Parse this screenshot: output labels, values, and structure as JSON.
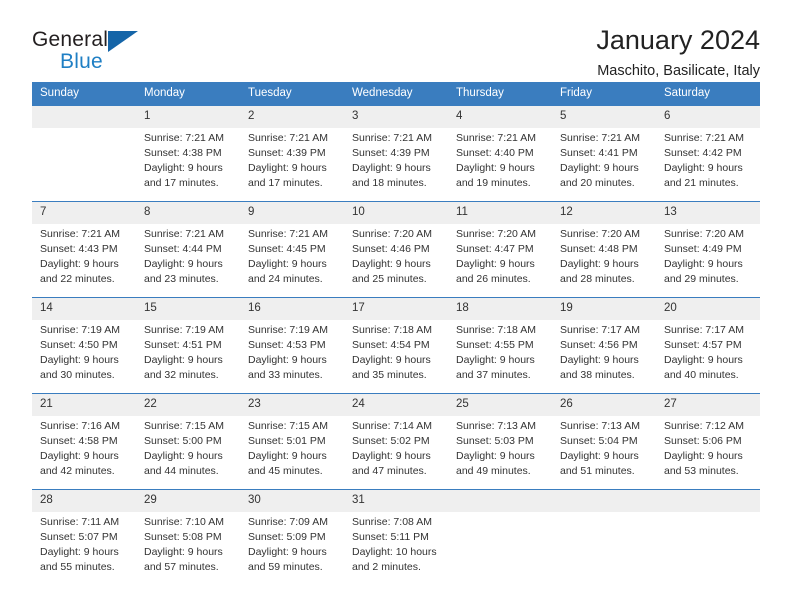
{
  "brand": {
    "name_top": "General",
    "name_bottom": "Blue",
    "triangle_icon": "triangle-logo-icon",
    "accent_color": "#1f7fc4"
  },
  "header": {
    "title": "January 2024",
    "subtitle": "Maschito, Basilicate, Italy"
  },
  "calendar": {
    "header_color": "#3a7dbf",
    "daynum_bg": "#efefef",
    "weekdays": [
      "Sunday",
      "Monday",
      "Tuesday",
      "Wednesday",
      "Thursday",
      "Friday",
      "Saturday"
    ],
    "weeks": [
      [
        {
          "day": "",
          "lines": [
            "",
            "",
            "",
            ""
          ]
        },
        {
          "day": "1",
          "lines": [
            "Sunrise: 7:21 AM",
            "Sunset: 4:38 PM",
            "Daylight: 9 hours",
            "and 17 minutes."
          ]
        },
        {
          "day": "2",
          "lines": [
            "Sunrise: 7:21 AM",
            "Sunset: 4:39 PM",
            "Daylight: 9 hours",
            "and 17 minutes."
          ]
        },
        {
          "day": "3",
          "lines": [
            "Sunrise: 7:21 AM",
            "Sunset: 4:39 PM",
            "Daylight: 9 hours",
            "and 18 minutes."
          ]
        },
        {
          "day": "4",
          "lines": [
            "Sunrise: 7:21 AM",
            "Sunset: 4:40 PM",
            "Daylight: 9 hours",
            "and 19 minutes."
          ]
        },
        {
          "day": "5",
          "lines": [
            "Sunrise: 7:21 AM",
            "Sunset: 4:41 PM",
            "Daylight: 9 hours",
            "and 20 minutes."
          ]
        },
        {
          "day": "6",
          "lines": [
            "Sunrise: 7:21 AM",
            "Sunset: 4:42 PM",
            "Daylight: 9 hours",
            "and 21 minutes."
          ]
        }
      ],
      [
        {
          "day": "7",
          "lines": [
            "Sunrise: 7:21 AM",
            "Sunset: 4:43 PM",
            "Daylight: 9 hours",
            "and 22 minutes."
          ]
        },
        {
          "day": "8",
          "lines": [
            "Sunrise: 7:21 AM",
            "Sunset: 4:44 PM",
            "Daylight: 9 hours",
            "and 23 minutes."
          ]
        },
        {
          "day": "9",
          "lines": [
            "Sunrise: 7:21 AM",
            "Sunset: 4:45 PM",
            "Daylight: 9 hours",
            "and 24 minutes."
          ]
        },
        {
          "day": "10",
          "lines": [
            "Sunrise: 7:20 AM",
            "Sunset: 4:46 PM",
            "Daylight: 9 hours",
            "and 25 minutes."
          ]
        },
        {
          "day": "11",
          "lines": [
            "Sunrise: 7:20 AM",
            "Sunset: 4:47 PM",
            "Daylight: 9 hours",
            "and 26 minutes."
          ]
        },
        {
          "day": "12",
          "lines": [
            "Sunrise: 7:20 AM",
            "Sunset: 4:48 PM",
            "Daylight: 9 hours",
            "and 28 minutes."
          ]
        },
        {
          "day": "13",
          "lines": [
            "Sunrise: 7:20 AM",
            "Sunset: 4:49 PM",
            "Daylight: 9 hours",
            "and 29 minutes."
          ]
        }
      ],
      [
        {
          "day": "14",
          "lines": [
            "Sunrise: 7:19 AM",
            "Sunset: 4:50 PM",
            "Daylight: 9 hours",
            "and 30 minutes."
          ]
        },
        {
          "day": "15",
          "lines": [
            "Sunrise: 7:19 AM",
            "Sunset: 4:51 PM",
            "Daylight: 9 hours",
            "and 32 minutes."
          ]
        },
        {
          "day": "16",
          "lines": [
            "Sunrise: 7:19 AM",
            "Sunset: 4:53 PM",
            "Daylight: 9 hours",
            "and 33 minutes."
          ]
        },
        {
          "day": "17",
          "lines": [
            "Sunrise: 7:18 AM",
            "Sunset: 4:54 PM",
            "Daylight: 9 hours",
            "and 35 minutes."
          ]
        },
        {
          "day": "18",
          "lines": [
            "Sunrise: 7:18 AM",
            "Sunset: 4:55 PM",
            "Daylight: 9 hours",
            "and 37 minutes."
          ]
        },
        {
          "day": "19",
          "lines": [
            "Sunrise: 7:17 AM",
            "Sunset: 4:56 PM",
            "Daylight: 9 hours",
            "and 38 minutes."
          ]
        },
        {
          "day": "20",
          "lines": [
            "Sunrise: 7:17 AM",
            "Sunset: 4:57 PM",
            "Daylight: 9 hours",
            "and 40 minutes."
          ]
        }
      ],
      [
        {
          "day": "21",
          "lines": [
            "Sunrise: 7:16 AM",
            "Sunset: 4:58 PM",
            "Daylight: 9 hours",
            "and 42 minutes."
          ]
        },
        {
          "day": "22",
          "lines": [
            "Sunrise: 7:15 AM",
            "Sunset: 5:00 PM",
            "Daylight: 9 hours",
            "and 44 minutes."
          ]
        },
        {
          "day": "23",
          "lines": [
            "Sunrise: 7:15 AM",
            "Sunset: 5:01 PM",
            "Daylight: 9 hours",
            "and 45 minutes."
          ]
        },
        {
          "day": "24",
          "lines": [
            "Sunrise: 7:14 AM",
            "Sunset: 5:02 PM",
            "Daylight: 9 hours",
            "and 47 minutes."
          ]
        },
        {
          "day": "25",
          "lines": [
            "Sunrise: 7:13 AM",
            "Sunset: 5:03 PM",
            "Daylight: 9 hours",
            "and 49 minutes."
          ]
        },
        {
          "day": "26",
          "lines": [
            "Sunrise: 7:13 AM",
            "Sunset: 5:04 PM",
            "Daylight: 9 hours",
            "and 51 minutes."
          ]
        },
        {
          "day": "27",
          "lines": [
            "Sunrise: 7:12 AM",
            "Sunset: 5:06 PM",
            "Daylight: 9 hours",
            "and 53 minutes."
          ]
        }
      ],
      [
        {
          "day": "28",
          "lines": [
            "Sunrise: 7:11 AM",
            "Sunset: 5:07 PM",
            "Daylight: 9 hours",
            "and 55 minutes."
          ]
        },
        {
          "day": "29",
          "lines": [
            "Sunrise: 7:10 AM",
            "Sunset: 5:08 PM",
            "Daylight: 9 hours",
            "and 57 minutes."
          ]
        },
        {
          "day": "30",
          "lines": [
            "Sunrise: 7:09 AM",
            "Sunset: 5:09 PM",
            "Daylight: 9 hours",
            "and 59 minutes."
          ]
        },
        {
          "day": "31",
          "lines": [
            "Sunrise: 7:08 AM",
            "Sunset: 5:11 PM",
            "Daylight: 10 hours",
            "and 2 minutes."
          ]
        },
        {
          "day": "",
          "lines": [
            "",
            "",
            "",
            ""
          ]
        },
        {
          "day": "",
          "lines": [
            "",
            "",
            "",
            ""
          ]
        },
        {
          "day": "",
          "lines": [
            "",
            "",
            "",
            ""
          ]
        }
      ]
    ]
  }
}
